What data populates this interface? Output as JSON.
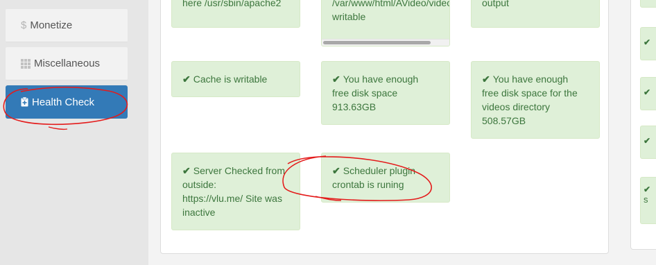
{
  "sidebar": {
    "items": [
      {
        "label": "Monetize",
        "icon": "dollar-icon"
      },
      {
        "label": "Miscellaneous",
        "icon": "grid-icon"
      },
      {
        "label": "Health Check",
        "icon": "clipboard-icon",
        "active": true
      }
    ]
  },
  "checks": {
    "top_left": "here /usr/sbin/apache2",
    "top_middle": "/var/www/html/AVideo/videos/ is writable",
    "top_right": "output",
    "cache": "Cache is writable",
    "disk_space_line1": "You have enough",
    "disk_space_line2": "free disk space",
    "disk_space_value": "913.63GB",
    "videos_space_line1": "You have enough",
    "videos_space_line2": "free disk space for the",
    "videos_space_line3": "videos directory",
    "videos_space_value": "508.57GB",
    "server_line1": "Server Checked from",
    "server_line2": "outside:",
    "server_line3": "https://vlu.me/ Site was",
    "server_line4": "inactive",
    "scheduler_line1": "Scheduler plugin",
    "scheduler_line2": "crontab is runing"
  },
  "right_column": {
    "partial_text": "s"
  },
  "colors": {
    "success_bg": "#dff0d8",
    "success_text": "#3c763d",
    "active_tab": "#337ab7",
    "annotation": "#e41b1b"
  }
}
